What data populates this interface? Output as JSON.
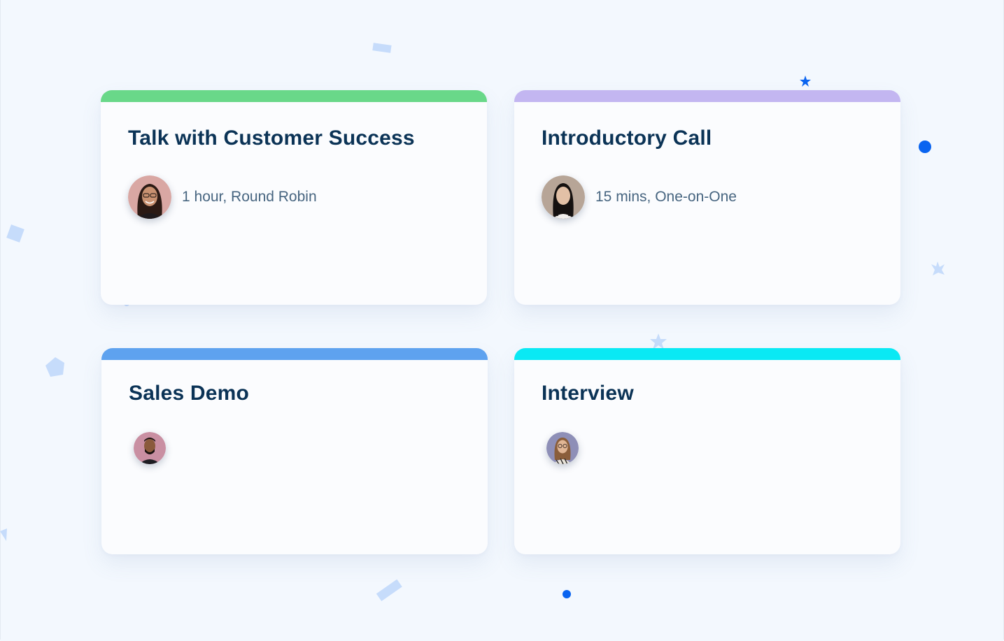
{
  "cards": [
    {
      "title": "Talk with Customer Success",
      "meta": "1 hour, Round Robin",
      "accent": "#69d889",
      "avatar_bg": "#d9a7a3"
    },
    {
      "title": "Introductory Call",
      "meta": "15 mins, One-on-One",
      "accent": "#c3b6f1",
      "avatar_bg": "#b7a597"
    },
    {
      "title": "Sales Demo",
      "meta": "",
      "accent": "#5ea2ef",
      "avatar_bg": "#c98fa2"
    },
    {
      "title": "Interview",
      "meta": "",
      "accent": "#0ae9f4",
      "avatar_bg": "#8e8fb7"
    }
  ],
  "confetti": {
    "icons": [
      "rectangle",
      "square",
      "pentagon",
      "star",
      "dot"
    ],
    "colors": {
      "light": "#c6dcfb",
      "dark": "#0a64f0"
    }
  }
}
